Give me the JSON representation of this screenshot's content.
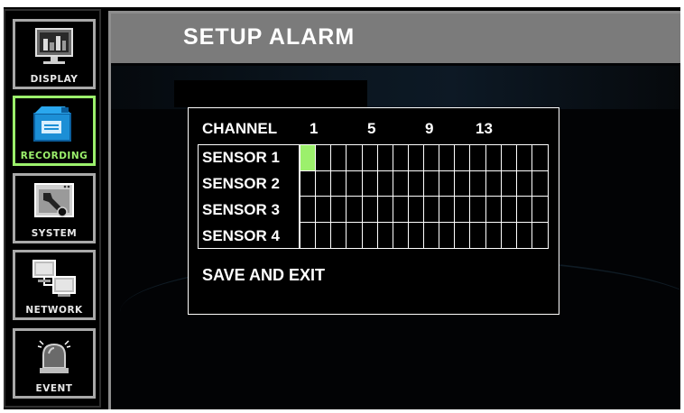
{
  "window": {
    "title": "SETUP ALARM"
  },
  "sidebar": {
    "active": "recording",
    "items": [
      {
        "id": "display",
        "label": "DISPLAY",
        "icon": "monitor-icon"
      },
      {
        "id": "recording",
        "label": "RECORDING",
        "icon": "camera-icon"
      },
      {
        "id": "system",
        "label": "SYSTEM",
        "icon": "wrench-icon"
      },
      {
        "id": "network",
        "label": "NETWORK",
        "icon": "network-icon"
      },
      {
        "id": "event",
        "label": "EVENT",
        "icon": "alarm-siren-icon"
      }
    ]
  },
  "alarm": {
    "channel_label": "CHANNEL",
    "channel_numbers": [
      "1",
      "5",
      "9",
      "13"
    ],
    "channels_total": 16,
    "sensors": [
      {
        "label": "SENSOR 1",
        "selected_channels": [
          1
        ]
      },
      {
        "label": "SENSOR 2",
        "selected_channels": []
      },
      {
        "label": "SENSOR 3",
        "selected_channels": []
      },
      {
        "label": "SENSOR 4",
        "selected_channels": []
      }
    ],
    "save_label": "SAVE AND EXIT"
  },
  "colors": {
    "accent": "#9cf06c",
    "titlebar": "#7b7b7b",
    "border": "#a9a9a9"
  }
}
